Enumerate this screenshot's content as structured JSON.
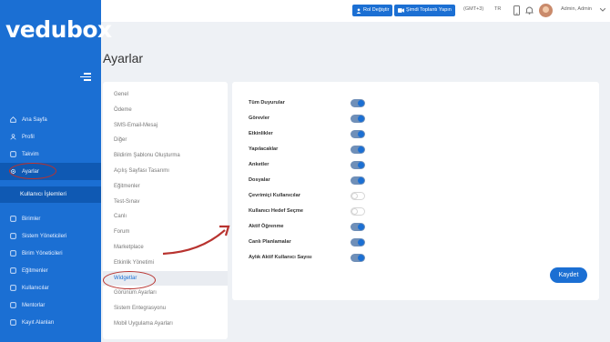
{
  "brand": {
    "logo_text": "vedubox",
    "accent": "#1b6fd3"
  },
  "topbar": {
    "role_button": "Rol Değiştir",
    "meeting_button": "Şimdi Toplantı Yapın",
    "timezone": "(GMT+3)",
    "language": "TR",
    "user_name": "Admin, Admin"
  },
  "page": {
    "title": "Ayarlar"
  },
  "sidebar": {
    "top_items": [
      {
        "label": "Ana Sayfa",
        "icon": "home-icon"
      },
      {
        "label": "Profil",
        "icon": "user-icon"
      },
      {
        "label": "Takvim",
        "icon": "calendar-icon"
      },
      {
        "label": "Ayarlar",
        "icon": "gear-icon",
        "active": true
      }
    ],
    "group_title": "Kullanıcı İşlemleri",
    "group_items": [
      {
        "label": "Birimler",
        "icon": "units-icon"
      },
      {
        "label": "Sistem Yöneticileri",
        "icon": "admins-icon"
      },
      {
        "label": "Birim Yöneticileri",
        "icon": "unit-admins-icon"
      },
      {
        "label": "Eğitmenler",
        "icon": "instructors-icon"
      },
      {
        "label": "Kullanıcılar",
        "icon": "users-icon"
      },
      {
        "label": "Mentorlar",
        "icon": "mentors-icon"
      },
      {
        "label": "Kayıt Alanları",
        "icon": "registration-icon"
      }
    ]
  },
  "settings_menu": [
    "Genel",
    "Ödeme",
    "SMS-Email-Mesaj",
    "Diğer",
    "Bildirim Şablonu Oluşturma",
    "Açılış Sayfası Tasarımı",
    "Eğitmenler",
    "Test-Sınav",
    "Canlı",
    "Forum",
    "Marketplace",
    "Etkinlik Yönetimi",
    "Widgetlar",
    "Görünüm Ayarları",
    "Sistem Entegrasyonu",
    "Mobil Uygulama Ayarları"
  ],
  "settings_menu_active": "Widgetlar",
  "widgets": [
    {
      "label": "Tüm Duyurular",
      "on": true
    },
    {
      "label": "Görevler",
      "on": true
    },
    {
      "label": "Etkinlikler",
      "on": true
    },
    {
      "label": "Yapılacaklar",
      "on": true
    },
    {
      "label": "Anketler",
      "on": true
    },
    {
      "label": "Dosyalar",
      "on": true
    },
    {
      "label": "Çevrimiçi Kullanıcılar",
      "on": false
    },
    {
      "label": "Kullanıcı Hedef Seçme",
      "on": false
    },
    {
      "label": "Aktif Öğrenme",
      "on": true
    },
    {
      "label": "Canlı Planlamalar",
      "on": true
    },
    {
      "label": "Aylık Aktif Kullanıcı Sayısı",
      "on": true
    }
  ],
  "save_label": "Kaydet"
}
